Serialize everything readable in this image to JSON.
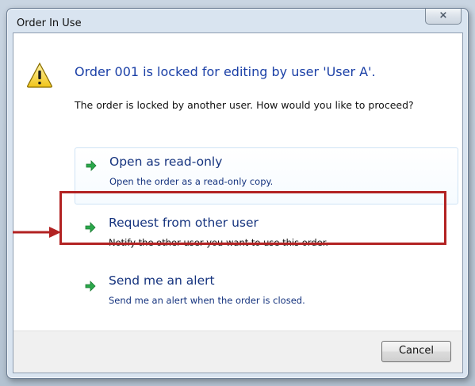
{
  "window": {
    "title": "Order In Use",
    "close_symbol": "⨯"
  },
  "dialog": {
    "main_instruction": "Order 001 is locked for editing by user 'User A'.",
    "content": "The order is locked by another user. How would you like to proceed?",
    "warning_icon": "warning-triangle-icon",
    "options": [
      {
        "title": "Open as read-only",
        "description": "Open the order as a read-only copy.",
        "icon": "green-arrow-icon"
      },
      {
        "title": "Request from other user",
        "description": "Notify the other user you want to use this order.",
        "icon": "green-arrow-icon"
      },
      {
        "title": "Send me an alert",
        "description": "Send me an alert when the order is closed.",
        "icon": "green-arrow-icon"
      }
    ],
    "cancel_label": "Cancel"
  },
  "colors": {
    "instruction_blue": "#1a3fa6",
    "option_title_blue": "#15337e",
    "highlight_red": "#b22222",
    "arrow_green": "#2aa84a"
  }
}
